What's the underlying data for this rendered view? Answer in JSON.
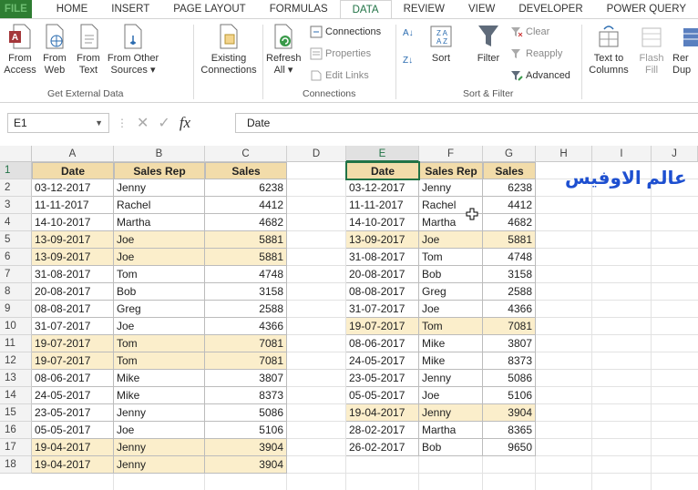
{
  "tabs": [
    "FILE",
    "HOME",
    "INSERT",
    "PAGE LAYOUT",
    "FORMULAS",
    "DATA",
    "REVIEW",
    "VIEW",
    "DEVELOPER",
    "POWER QUERY"
  ],
  "active_tab": "DATA",
  "ribbon": {
    "from_access": [
      "From",
      "Access"
    ],
    "from_web": [
      "From",
      "Web"
    ],
    "from_text": [
      "From",
      "Text"
    ],
    "from_other": [
      "From Other",
      "Sources ▾"
    ],
    "existing": [
      "Existing",
      "Connections"
    ],
    "get_external_label": "Get External Data",
    "refresh": [
      "Refresh",
      "All ▾"
    ],
    "connections": "Connections",
    "properties": "Properties",
    "edit_links": "Edit Links",
    "connections_label": "Connections",
    "sort": "Sort",
    "filter": "Filter",
    "clear": "Clear",
    "reapply": "Reapply",
    "advanced": "Advanced",
    "sort_filter_label": "Sort & Filter",
    "text_to_columns": [
      "Text to",
      "Columns"
    ],
    "flash_fill": [
      "Flash",
      "Fill"
    ],
    "remove_dup": [
      "Rer",
      "Dup"
    ]
  },
  "formula_bar": {
    "name_box": "E1",
    "fx": "fx",
    "formula": "Date"
  },
  "columns": [
    "A",
    "B",
    "C",
    "D",
    "E",
    "F",
    "G",
    "H",
    "I",
    "J"
  ],
  "rows": [
    "1",
    "2",
    "3",
    "4",
    "5",
    "6",
    "7",
    "8",
    "9",
    "10",
    "11",
    "12",
    "13",
    "14",
    "15",
    "16",
    "17",
    "18"
  ],
  "left_table": {
    "headers": [
      "Date",
      "Sales Rep",
      "Sales"
    ],
    "rows": [
      {
        "date": "03-12-2017",
        "rep": "Jenny",
        "sales": "6238",
        "hl": false
      },
      {
        "date": "11-11-2017",
        "rep": "Rachel",
        "sales": "4412",
        "hl": false
      },
      {
        "date": "14-10-2017",
        "rep": "Martha",
        "sales": "4682",
        "hl": false
      },
      {
        "date": "13-09-2017",
        "rep": "Joe",
        "sales": "5881",
        "hl": true
      },
      {
        "date": "13-09-2017",
        "rep": "Joe",
        "sales": "5881",
        "hl": true
      },
      {
        "date": "31-08-2017",
        "rep": "Tom",
        "sales": "4748",
        "hl": false
      },
      {
        "date": "20-08-2017",
        "rep": "Bob",
        "sales": "3158",
        "hl": false
      },
      {
        "date": "08-08-2017",
        "rep": "Greg",
        "sales": "2588",
        "hl": false
      },
      {
        "date": "31-07-2017",
        "rep": "Joe",
        "sales": "4366",
        "hl": false
      },
      {
        "date": "19-07-2017",
        "rep": "Tom",
        "sales": "7081",
        "hl": true
      },
      {
        "date": "19-07-2017",
        "rep": "Tom",
        "sales": "7081",
        "hl": true
      },
      {
        "date": "08-06-2017",
        "rep": "Mike",
        "sales": "3807",
        "hl": false
      },
      {
        "date": "24-05-2017",
        "rep": "Mike",
        "sales": "8373",
        "hl": false
      },
      {
        "date": "23-05-2017",
        "rep": "Jenny",
        "sales": "5086",
        "hl": false
      },
      {
        "date": "05-05-2017",
        "rep": "Joe",
        "sales": "5106",
        "hl": false
      },
      {
        "date": "19-04-2017",
        "rep": "Jenny",
        "sales": "3904",
        "hl": true
      },
      {
        "date": "19-04-2017",
        "rep": "Jenny",
        "sales": "3904",
        "hl": true
      }
    ]
  },
  "right_table": {
    "headers": [
      "Date",
      "Sales Rep",
      "Sales"
    ],
    "rows": [
      {
        "date": "03-12-2017",
        "rep": "Jenny",
        "sales": "6238",
        "hl": false
      },
      {
        "date": "11-11-2017",
        "rep": "Rachel",
        "sales": "4412",
        "hl": false
      },
      {
        "date": "14-10-2017",
        "rep": "Martha",
        "sales": "4682",
        "hl": false
      },
      {
        "date": "13-09-2017",
        "rep": "Joe",
        "sales": "5881",
        "hl": true
      },
      {
        "date": "31-08-2017",
        "rep": "Tom",
        "sales": "4748",
        "hl": false
      },
      {
        "date": "20-08-2017",
        "rep": "Bob",
        "sales": "3158",
        "hl": false
      },
      {
        "date": "08-08-2017",
        "rep": "Greg",
        "sales": "2588",
        "hl": false
      },
      {
        "date": "31-07-2017",
        "rep": "Joe",
        "sales": "4366",
        "hl": false
      },
      {
        "date": "19-07-2017",
        "rep": "Tom",
        "sales": "7081",
        "hl": true
      },
      {
        "date": "08-06-2017",
        "rep": "Mike",
        "sales": "3807",
        "hl": false
      },
      {
        "date": "24-05-2017",
        "rep": "Mike",
        "sales": "8373",
        "hl": false
      },
      {
        "date": "23-05-2017",
        "rep": "Jenny",
        "sales": "5086",
        "hl": false
      },
      {
        "date": "05-05-2017",
        "rep": "Joe",
        "sales": "5106",
        "hl": false
      },
      {
        "date": "19-04-2017",
        "rep": "Jenny",
        "sales": "3904",
        "hl": true
      },
      {
        "date": "28-02-2017",
        "rep": "Martha",
        "sales": "8365",
        "hl": false
      },
      {
        "date": "26-02-2017",
        "rep": "Bob",
        "sales": "9650",
        "hl": false
      }
    ]
  },
  "watermark": "عالم الاوفيس",
  "colors": {
    "accent": "#217346",
    "header_fill": "#f2dcaa",
    "highlight_fill": "#fbeecb",
    "watermark": "#1d4fd0"
  }
}
